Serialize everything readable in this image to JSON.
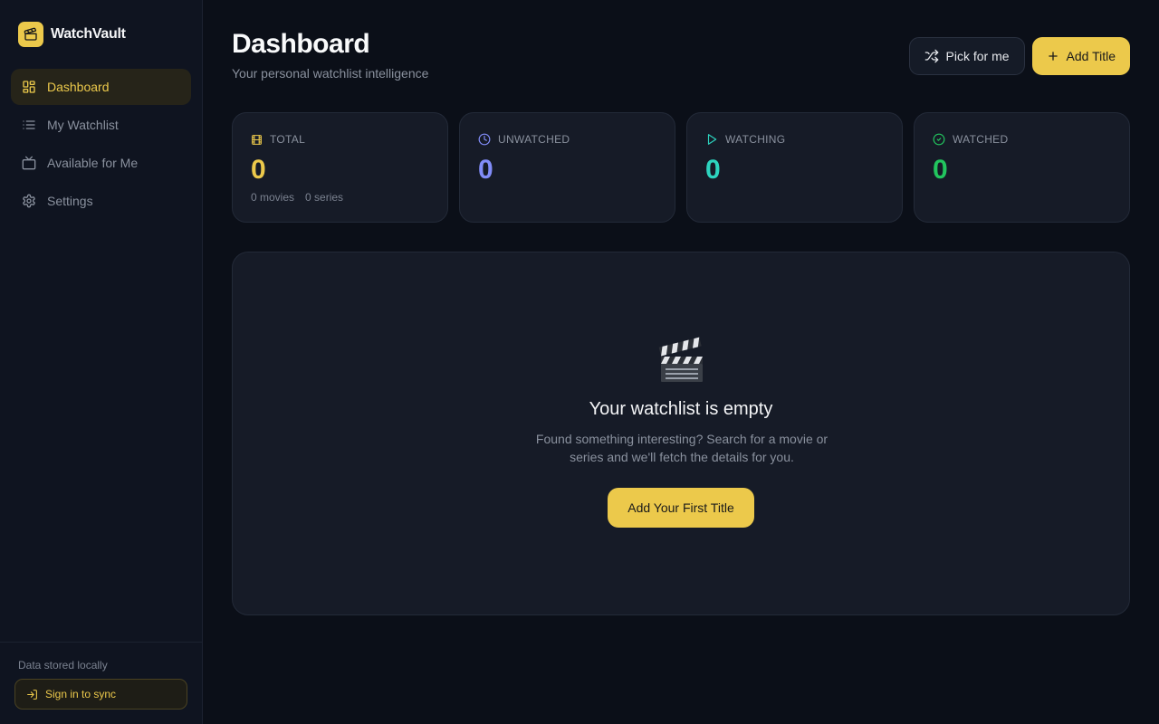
{
  "brand": {
    "name": "WatchVault",
    "icon": "clapperboard-icon",
    "accent": "#ecc94b"
  },
  "nav": {
    "items": [
      {
        "label": "Dashboard",
        "icon": "dashboard-grid-icon",
        "active": true
      },
      {
        "label": "My Watchlist",
        "icon": "list-icon",
        "active": false
      },
      {
        "label": "Available for Me",
        "icon": "tv-icon",
        "active": false
      },
      {
        "label": "Settings",
        "icon": "gear-icon",
        "active": false
      }
    ]
  },
  "sidebar_footer": {
    "storage_note": "Data stored locally",
    "sync_label": "Sign in to sync",
    "sync_icon": "sign-in-icon"
  },
  "header": {
    "title": "Dashboard",
    "subtitle": "Your personal watchlist intelligence",
    "pick_label": "Pick for me",
    "pick_icon": "shuffle-icon",
    "add_label": "Add Title",
    "add_icon": "plus-icon"
  },
  "stats": [
    {
      "label": "TOTAL",
      "value": "0",
      "icon": "film-icon",
      "color": "#ecc94b",
      "sub": [
        "0 movies",
        "0 series"
      ]
    },
    {
      "label": "UNWATCHED",
      "value": "0",
      "icon": "clock-icon",
      "color": "#818cf8",
      "sub": []
    },
    {
      "label": "WATCHING",
      "value": "0",
      "icon": "play-icon",
      "color": "#2dd4bf",
      "sub": []
    },
    {
      "label": "WATCHED",
      "value": "0",
      "icon": "check-circle-icon",
      "color": "#22c55e",
      "sub": []
    }
  ],
  "empty_state": {
    "icon": "clapper-emoji-icon",
    "title": "Your watchlist is empty",
    "description": "Found something interesting? Search for a movie or series and we'll fetch the details for you.",
    "cta_label": "Add Your First Title"
  }
}
